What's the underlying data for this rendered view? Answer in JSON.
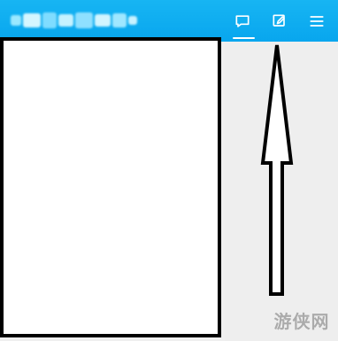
{
  "colors": {
    "topbar": "#0aa8ef",
    "icon": "#ffffff",
    "panel_border": "#000000",
    "panel_fill": "#ffffff",
    "background": "#eeeeee"
  },
  "topbar": {
    "icons": [
      "chat-icon",
      "edit-icon",
      "menu-icon"
    ],
    "active_icon": "chat-icon"
  },
  "watermark": {
    "text": "游侠网"
  }
}
